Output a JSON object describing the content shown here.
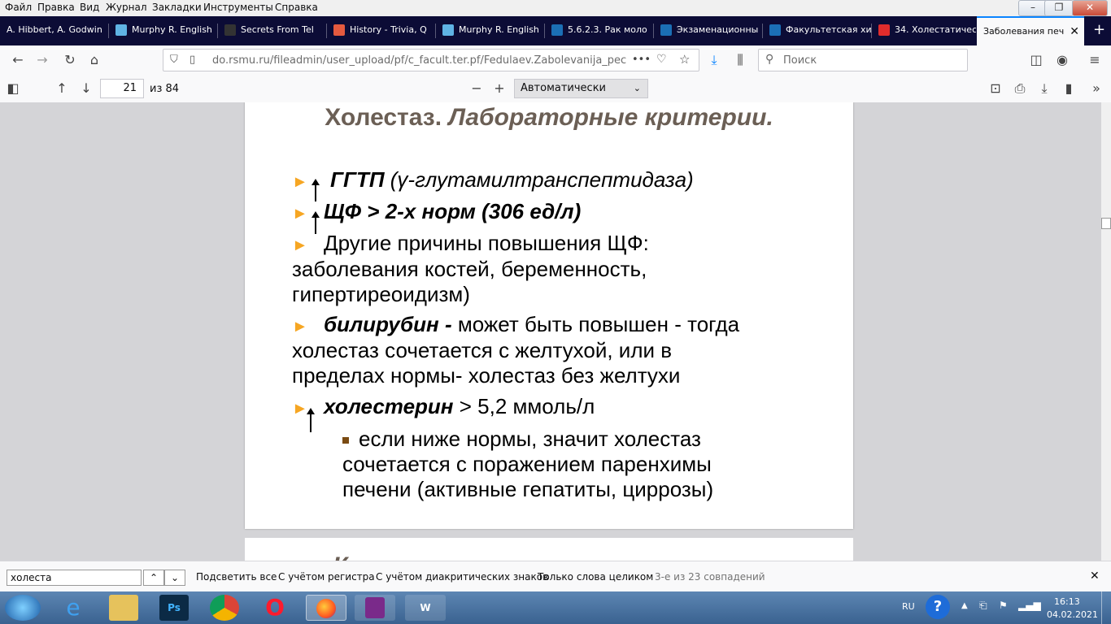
{
  "menu": [
    "Файл",
    "Правка",
    "Вид",
    "Журнал",
    "Закладки",
    "Инструменты",
    "Справка"
  ],
  "tabs": [
    {
      "label": "A. Hibbert, A. Godwin",
      "color": "#1c1c40"
    },
    {
      "label": "Murphy R. English",
      "color": "#5fb3e4"
    },
    {
      "label": "Secrets From Tel",
      "color": "#333333"
    },
    {
      "label": "History - Trivia, Q",
      "color": "#e55a3f"
    },
    {
      "label": "Murphy R. English",
      "color": "#5fb3e4"
    },
    {
      "label": "5.6.2.3. Рак моло",
      "color": "#1b6fb5"
    },
    {
      "label": "Экзаменационны",
      "color": "#1b6fb5"
    },
    {
      "label": "Факультетская хи",
      "color": "#1b6fb5"
    },
    {
      "label": "34. Холестатичес",
      "color": "#e02c2c"
    },
    {
      "label": "Заболевания печ",
      "color": "#f9f9fa"
    }
  ],
  "address": {
    "url": "do.rsmu.ru/fileadmin/user_upload/pf/c_facult.ter.pf/Fedulaev.Zabolevanija_pecheni.p",
    "dots": "•••"
  },
  "search": {
    "placeholder": "Поиск"
  },
  "pdf": {
    "page": "21",
    "of": "из 84",
    "zoom": "Автоматически"
  },
  "slide": {
    "title_main": "Холестаз.",
    "title_italic": "Лабораторные критерии.",
    "items": [
      {
        "bold": "ГГТП",
        "rest": "(γ-глутамилтранспептидаза)"
      },
      {
        "bold": "ЩФ",
        "rest": "> 2-х норм (306 ед/л)"
      },
      {
        "text1": "Другие причины повышения ЩФ:",
        "text2": "заболевания костей, беременность,",
        "text3": "гипертиреоидизм)"
      },
      {
        "bold": "билирубин -",
        "rest": "может быть повышен - тогда",
        "line2": "холестаз сочетается с желтухой, или в",
        "line3": "пределах нормы- холестаз без желтухи"
      },
      {
        "bold": "холестерин",
        "rest": "> 5,2 ммоль/л"
      },
      {
        "sub1": "если ниже нормы, значит холестаз",
        "sub2": "сочетается с поражением паренхимы",
        "sub3": "печени (активные гепатиты, циррозы)"
      }
    ],
    "next_slide_peek": "К"
  },
  "find": {
    "query": "холеста",
    "highlight_all": "Подсветить все",
    "match_case": "С учётом регистра",
    "diacritics": "С учётом диакритических знаков",
    "whole_words": "Только слова целиком",
    "status": "3-е из 23 совпадений"
  },
  "taskbar": {
    "lang": "RU",
    "time": "16:13",
    "date": "04.02.2021"
  }
}
